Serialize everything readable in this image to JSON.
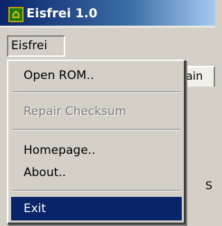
{
  "window": {
    "title": "Eisfrei 1.0",
    "icon": "eisfrei-app-icon"
  },
  "menubar": {
    "items": [
      {
        "label": "Eisfrei"
      }
    ]
  },
  "background": {
    "tab_label": "ain",
    "partial_text": "S"
  },
  "dropdown": {
    "items": [
      {
        "label": "Open ROM..",
        "enabled": true
      },
      {
        "label": "Repair Checksum",
        "enabled": false
      },
      {
        "label": "Homepage..",
        "enabled": true
      },
      {
        "label": "About..",
        "enabled": true
      },
      {
        "label": "Exit",
        "enabled": true,
        "highlighted": true
      }
    ]
  },
  "colors": {
    "titlebar": "#0a246a",
    "face": "#d4d0c8",
    "highlight": "#0a246a",
    "disabled_text": "#808080"
  }
}
